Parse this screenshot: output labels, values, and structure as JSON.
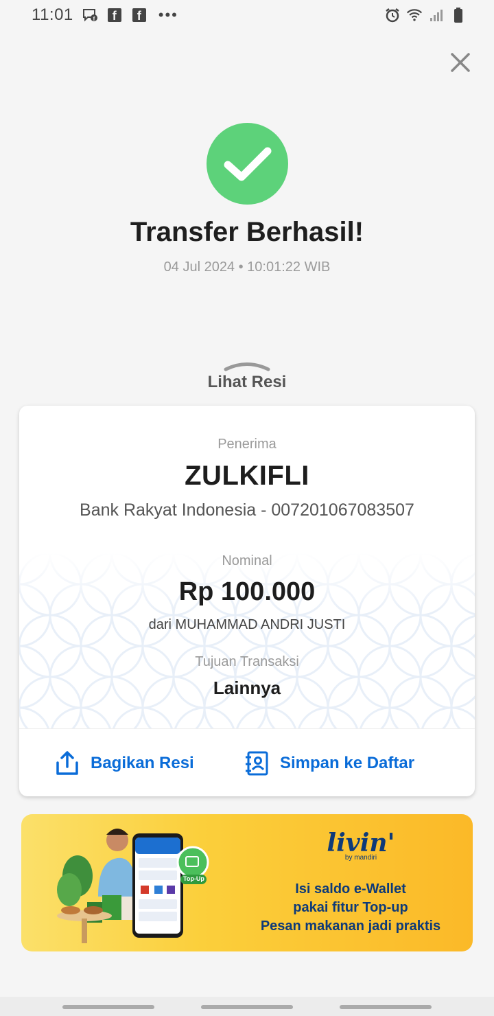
{
  "status_bar": {
    "time": "11:01",
    "dots": "•••"
  },
  "header": {
    "title": "Transfer Berhasil!",
    "datetime": "04 Jul 2024 • 10:01:22 WIB"
  },
  "resi_toggle": {
    "label": "Lihat Resi"
  },
  "receipt": {
    "recipient_label": "Penerima",
    "recipient_name": "ZULKIFLI",
    "recipient_bank": "Bank Rakyat Indonesia - 007201067083507",
    "amount_label": "Nominal",
    "amount": "Rp 100.000",
    "from": "dari MUHAMMAD ANDRI JUSTI",
    "purpose_label": "Tujuan Transaksi",
    "purpose": "Lainnya"
  },
  "actions": {
    "share_label": "Bagikan Resi",
    "save_label": "Simpan ke Daftar"
  },
  "banner": {
    "brand": "livin'",
    "brand_by": "by mandiri",
    "line1": "Isi saldo e-Wallet",
    "line2": "pakai fitur Top-up",
    "line3": "Pesan makanan jadi praktis",
    "badge": "Top-Up"
  },
  "colors": {
    "success": "#5dd27a",
    "link": "#0a6cd8",
    "banner_text": "#0e3a78"
  }
}
